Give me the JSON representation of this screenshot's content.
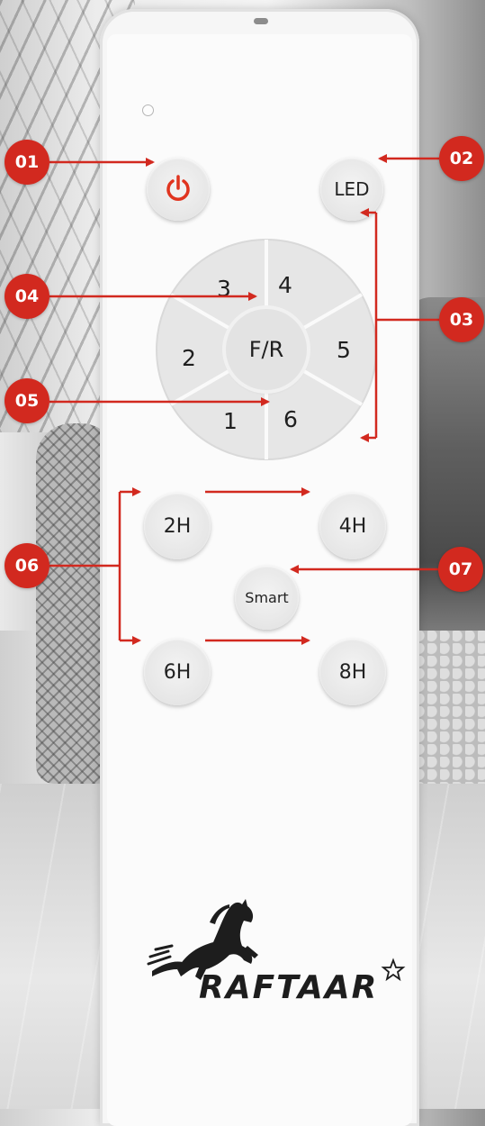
{
  "remote": {
    "power_icon": "power-icon",
    "led_label": "LED",
    "speed_buttons": [
      {
        "label": "3"
      },
      {
        "label": "4"
      },
      {
        "label": "2"
      },
      {
        "label": "5"
      },
      {
        "label": "1"
      },
      {
        "label": "6"
      }
    ],
    "center_label": "F/R",
    "timers": {
      "t2": "2H",
      "t4": "4H",
      "t6": "6H",
      "t8": "8H"
    },
    "smart_label": "Smart",
    "brand": "RAFTAAR",
    "brand_logo_icon": "horse-logo-icon"
  },
  "callouts": {
    "c01": "01",
    "c02": "02",
    "c03": "03",
    "c04": "04",
    "c05": "05",
    "c06": "06",
    "c07": "07"
  },
  "colors": {
    "accent_red": "#d2291f",
    "power_icon_red": "#e0341f",
    "remote_body": "#f6f6f6"
  }
}
